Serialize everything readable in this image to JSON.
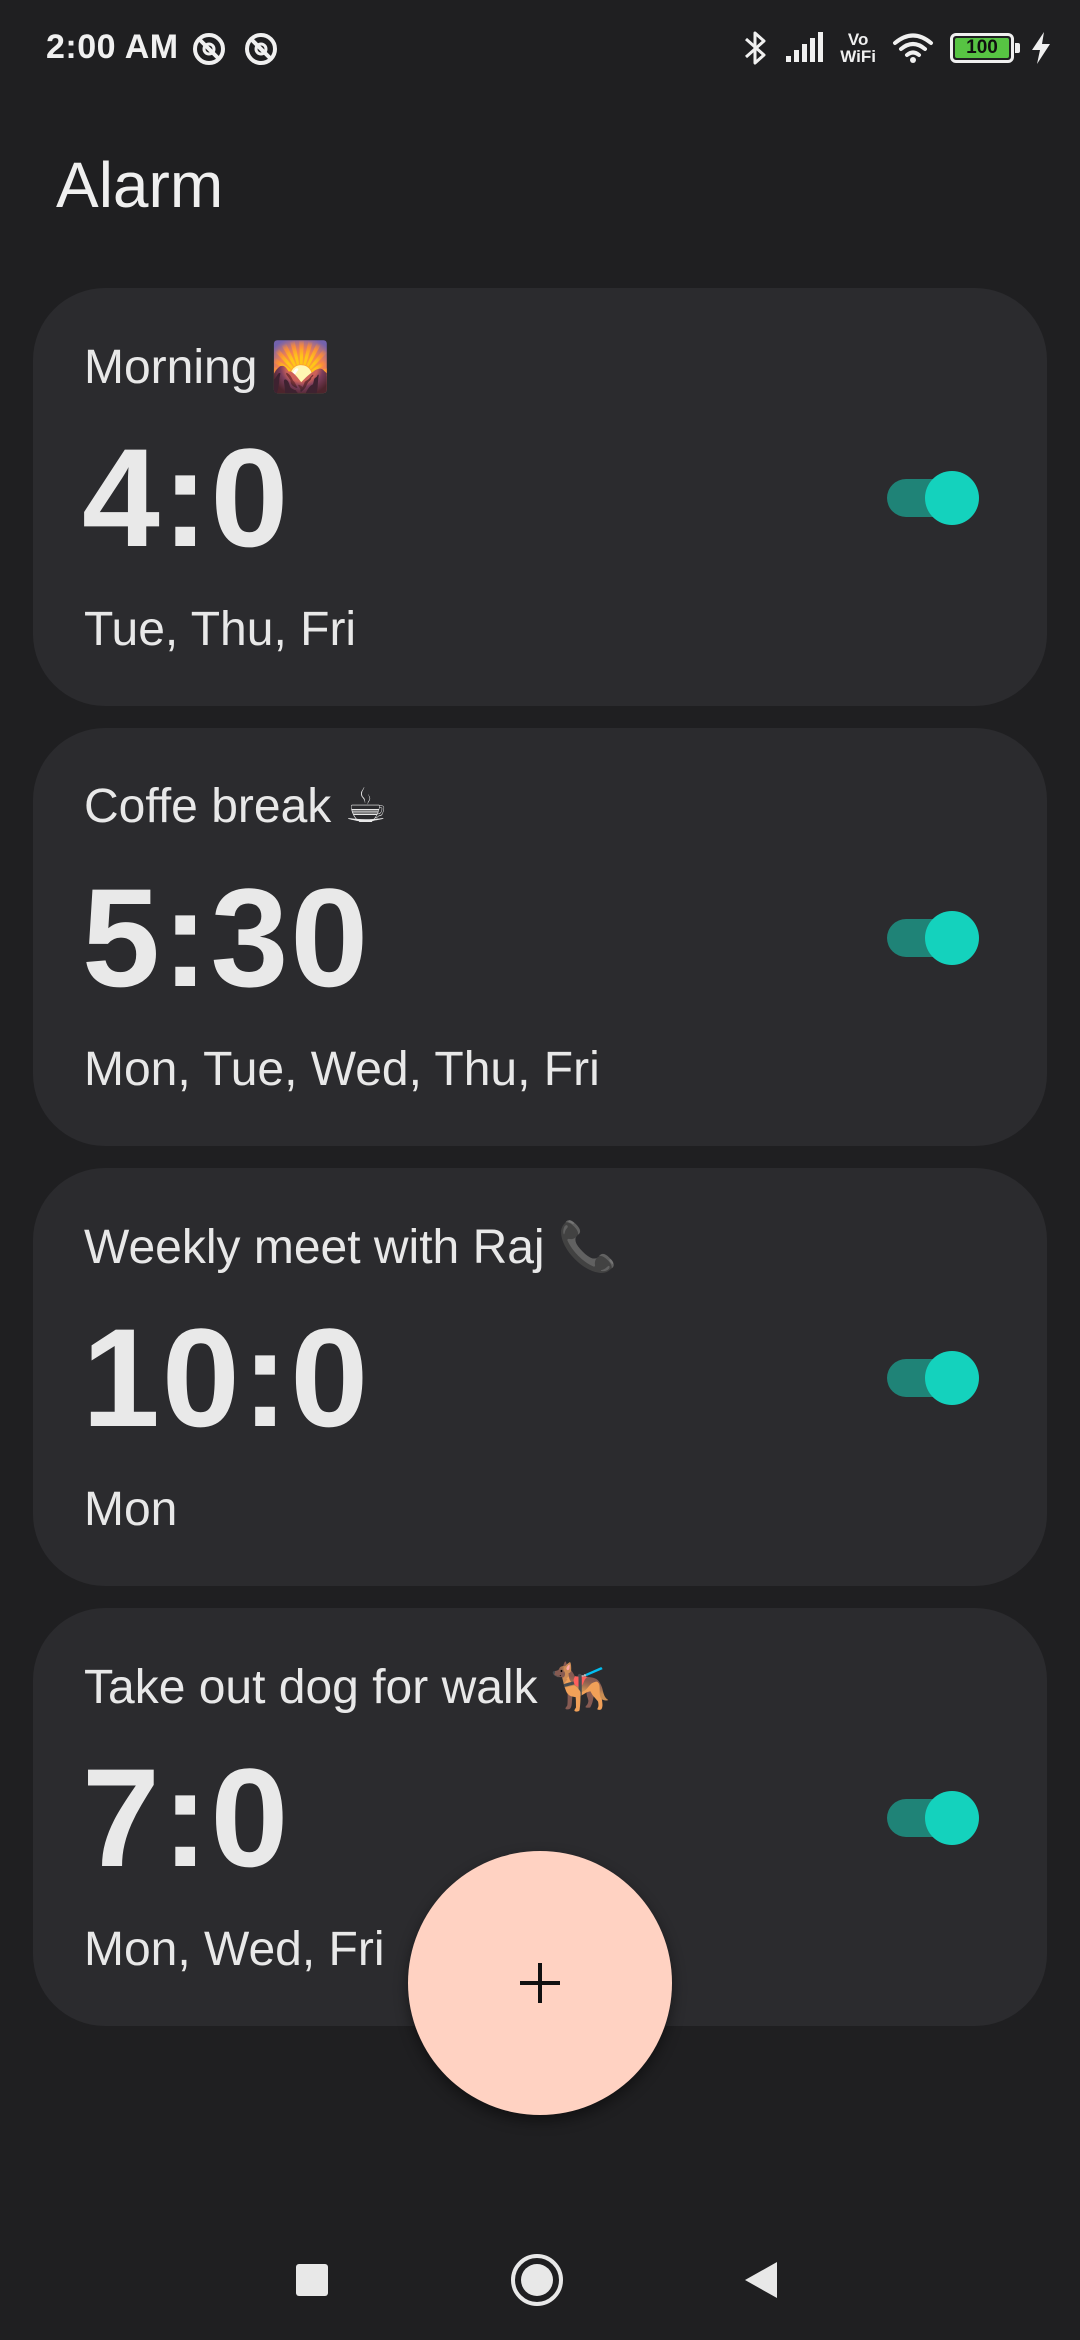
{
  "status_bar": {
    "time": "2:00 AM",
    "vowifi_top": "Vo",
    "vowifi_bottom": "WiFi",
    "battery_level": "100",
    "battery_color": "#57c443"
  },
  "header": {
    "title": "Alarm"
  },
  "alarms": [
    {
      "label": "Morning 🌄",
      "time": "4:0",
      "days": "Tue, Thu, Fri",
      "enabled": true
    },
    {
      "label": "Coffe break ☕",
      "time": "5:30",
      "days": "Mon, Tue, Wed, Thu, Fri",
      "enabled": true
    },
    {
      "label": "Weekly meet with Raj 📞",
      "time": "10:0",
      "days": "Mon",
      "enabled": true
    },
    {
      "label": "Take out dog for walk 🐕‍🦺",
      "time": "7:0",
      "days": "Mon, Wed, Fri",
      "enabled": true
    }
  ],
  "fab": {
    "icon": "plus-icon",
    "color": "#ffd2c2"
  },
  "colors": {
    "background": "#1f1f21",
    "card": "#2b2b2e",
    "toggle_track": "#1f8377",
    "toggle_thumb": "#14d2bd"
  },
  "nav": {
    "items": [
      "recents-square-icon",
      "home-circle-icon",
      "back-triangle-icon"
    ]
  }
}
